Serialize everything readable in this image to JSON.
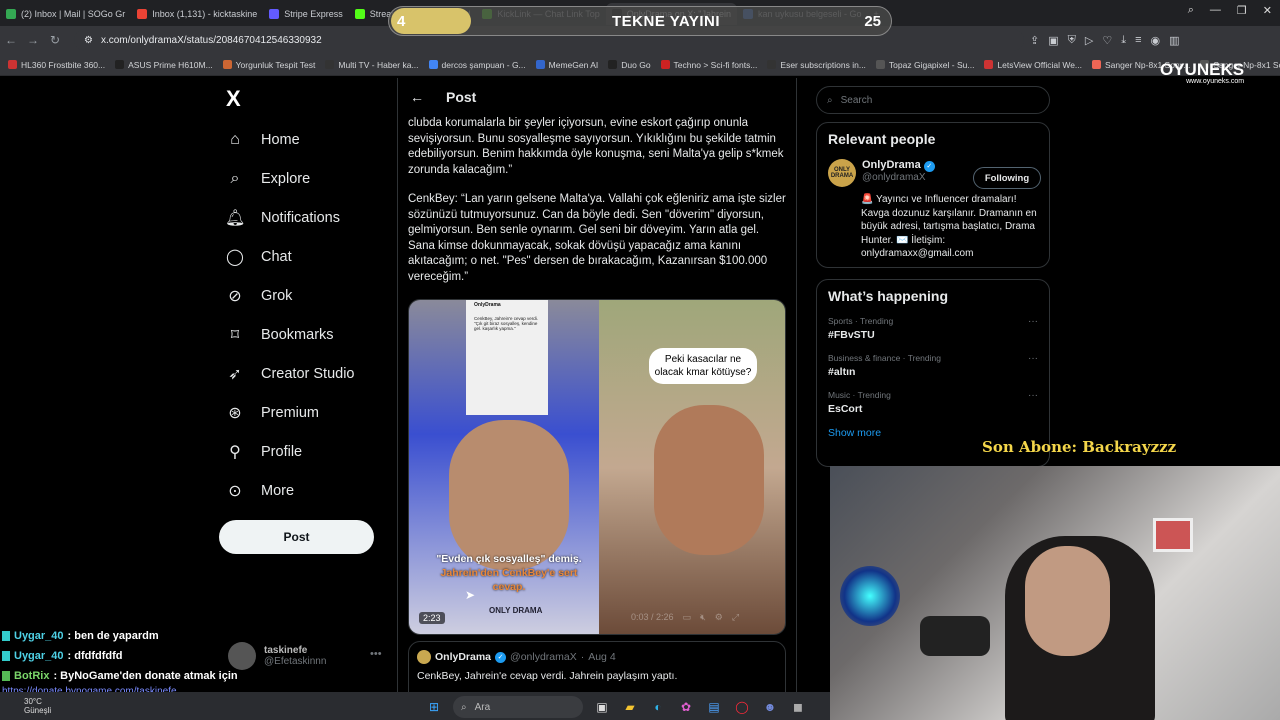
{
  "browser": {
    "tabs": [
      {
        "label": "(2) Inbox | Mail | SOGo Gr",
        "color": "#34a853",
        "active": false
      },
      {
        "label": "Inbox (1,131) - kicktaskine",
        "color": "#ea4335",
        "active": false
      },
      {
        "label": "Stripe Express",
        "color": "#635bff",
        "active": false
      },
      {
        "label": "Stream - Kick Dashboard",
        "color": "#53fc18",
        "active": false
      },
      {
        "label": "KickLink — Chat Link Top",
        "color": "#53fc18",
        "active": false
      },
      {
        "label": "OnlyDrama on X: \"Jahrein",
        "color": "#000000",
        "active": true
      },
      {
        "label": "kan uykusu belgeseli - Go",
        "color": "#4285f4",
        "active": false
      }
    ],
    "url": "x.com/onlydramaX/status/2084670412546330932",
    "bookmarks": [
      {
        "label": "HL360 Frostbite 360...",
        "color": "#c33"
      },
      {
        "label": "ASUS Prime H610M...",
        "color": "#222"
      },
      {
        "label": "Yorgunluk Tespit Test",
        "color": "#c63"
      },
      {
        "label": "Multi TV - Haber ka...",
        "color": "#333"
      },
      {
        "label": "dercos şampuan - G...",
        "color": "#4285f4"
      },
      {
        "label": "MemeGen AI",
        "color": "#36c"
      },
      {
        "label": "Duo Go",
        "color": "#222"
      },
      {
        "label": "Techno > Sci-fi fonts...",
        "color": "#c22"
      },
      {
        "label": "Eser subscriptions in...",
        "color": "#333"
      },
      {
        "label": "Topaz Gigapixel - Su...",
        "color": "#555"
      },
      {
        "label": "LetsView Official We...",
        "color": "#c33"
      },
      {
        "label": "Sanger Np-8x1 Sony...",
        "color": "#e65"
      },
      {
        "label": "Sanger Np-8x1 Son...",
        "color": "#555"
      }
    ]
  },
  "stream": {
    "left_count": "4",
    "title": "TEKNE YAYINI",
    "right_count": "25",
    "brand": "OYUNEKS",
    "brand_url": "www.oyuneks.com",
    "son_abone": "Son Abone: Backrayzzz"
  },
  "sidebar": {
    "logo": "X",
    "items": [
      {
        "label": "Home",
        "icon": "home-icon",
        "glyph": "⌂"
      },
      {
        "label": "Explore",
        "icon": "search-icon",
        "glyph": "⌕"
      },
      {
        "label": "Notifications",
        "icon": "bell-icon",
        "glyph": "🔔︎"
      },
      {
        "label": "Chat",
        "icon": "chat-icon",
        "glyph": "◯"
      },
      {
        "label": "Grok",
        "icon": "grok-icon",
        "glyph": "⊘"
      },
      {
        "label": "Bookmarks",
        "icon": "bookmark-icon",
        "glyph": "⌑"
      },
      {
        "label": "Creator Studio",
        "icon": "rocket-icon",
        "glyph": "➶"
      },
      {
        "label": "Premium",
        "icon": "premium-icon",
        "glyph": "⊛"
      },
      {
        "label": "Profile",
        "icon": "person-icon",
        "glyph": "⚲"
      },
      {
        "label": "More",
        "icon": "more-icon",
        "glyph": "⊙"
      }
    ],
    "post_label": "Post",
    "account_name": "taskinefe",
    "account_handle": "@Efetaskinnn"
  },
  "main": {
    "header_title": "Post",
    "paragraphs": [
      "clubda korumalarla bir şeyler içiyorsun, evine eskort çağırıp onunla sevişiyorsun. Bunu sosyalleşme sayıyorsun. Yıkıklığını bu şekilde tatmin edebiliyorsun. Benim hakkımda öyle konuşma, seni Malta'ya gelip s*kmek zorunda kalacağım.”",
      "CenkBey: “Lan yarın gelsene Malta'ya. Vallahi çok eğleniriz ama işte sizler sözünüzü tutmuyorsunuz. Can da böyle dedi. Sen \"döverim\" diyorsun, gelmiyorsun. Ben senle oynarım. Gel seni bir döveyim. Yarın atla gel. Sana kimse dokunmayacak, sokak dövüşü yapacağız ama kanını akıtacağım; o net. \"Pes\" dersen de bırakacağım, Kazanırsan $100.000 vereceğim.”"
    ],
    "video": {
      "inset_name": "OnlyDrama",
      "inset_text": "CenkBey, Jahrein'e cevap verdi. \"Çık git biraz sosyalleş, kendine gel. kaşarlık yapma.\"",
      "bubble": "Peki kasacılar ne olacak kmar kötüyse?",
      "caption_1": "\"Evden çık sosyalleş\" demiş.",
      "caption_2": "Jahrein'den CenkBey'e sert cevap.",
      "logo": "ONLY DRAMA",
      "time": "2:23",
      "progress": "0:03 / 2:26"
    },
    "quote": {
      "name": "OnlyDrama",
      "handle": "@onlydramaX",
      "date": "Aug 4",
      "text": "CenkBey, Jahrein'e cevap verdi. Jahrein paylaşım yaptı."
    }
  },
  "right": {
    "search_placeholder": "Search",
    "relevant_title": "Relevant people",
    "person": {
      "name": "OnlyDrama",
      "handle": "@onlydramaX",
      "follow_label": "Following",
      "avatar_text": "ONLY DRAMA",
      "bio": "🚨 Yayıncı ve Influencer dramaları! Kavga dozunuz karşılanır. Dramanın en büyük adresi, tartışma başlatıcı, Drama Hunter. ✉️ İletişim: onlydramaxx@gmail.com"
    },
    "happening_title": "What’s happening",
    "trends": [
      {
        "category": "Sports · Trending",
        "topic": "#FBvSTU"
      },
      {
        "category": "Business & finance · Trending",
        "topic": "#altın"
      },
      {
        "category": "Music · Trending",
        "topic": "EsCort"
      }
    ],
    "show_more": "Show more"
  },
  "chat": {
    "lines": [
      {
        "user": "Uygar_40",
        "message": ": ben de yapardm",
        "bot": false
      },
      {
        "user": "Uygar_40",
        "message": ": dfdfdfdfd",
        "bot": false
      },
      {
        "user": "BotRix",
        "message": ": ByNoGame'den donate atmak için",
        "bot": true
      }
    ],
    "link": "https://donate.bynogame.com/taskinefe"
  },
  "taskbar": {
    "temp": "30°C",
    "weather": "Güneşli",
    "search_placeholder": "Ara"
  }
}
